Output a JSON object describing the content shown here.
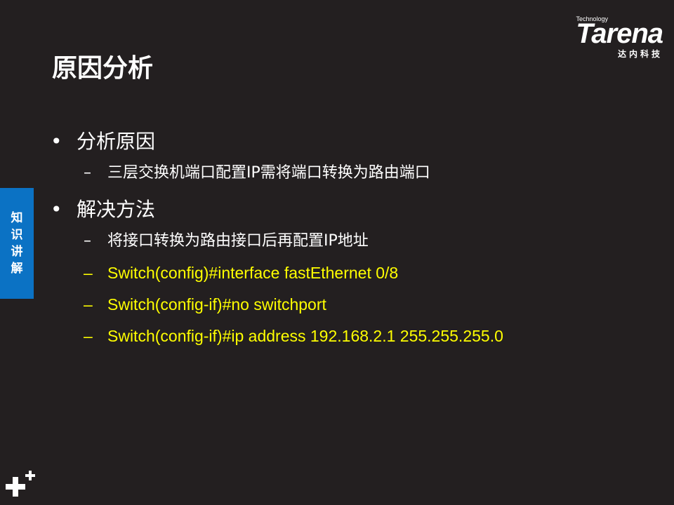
{
  "logo": {
    "tagline": "Technology",
    "brand": "Tarena",
    "cn_name": "达内科技"
  },
  "slide": {
    "title": "原因分析"
  },
  "side_tab": {
    "chars": [
      "知",
      "识",
      "讲",
      "解"
    ]
  },
  "bullets": [
    {
      "text": "分析原因",
      "children": [
        {
          "text": "三层交换机端口配置IP需将端口转换为路由端口",
          "code": false
        }
      ]
    },
    {
      "text": "解决方法",
      "children": [
        {
          "text": "将接口转换为路由接口后再配置IP地址",
          "code": false
        },
        {
          "text": "Switch(config)#interface fastEthernet 0/8",
          "code": true
        },
        {
          "text": "Switch(config-if)#no switchport",
          "code": true
        },
        {
          "text": "Switch(config-if)#ip address 192.168.2.1 255.255.255.0",
          "code": true
        }
      ]
    }
  ],
  "symbols": {
    "bullet": "•",
    "dash": "–"
  },
  "colors": {
    "background": "#231f20",
    "code_text": "#ffff00",
    "side_tab": "#0b72c4",
    "text": "#ffffff"
  }
}
